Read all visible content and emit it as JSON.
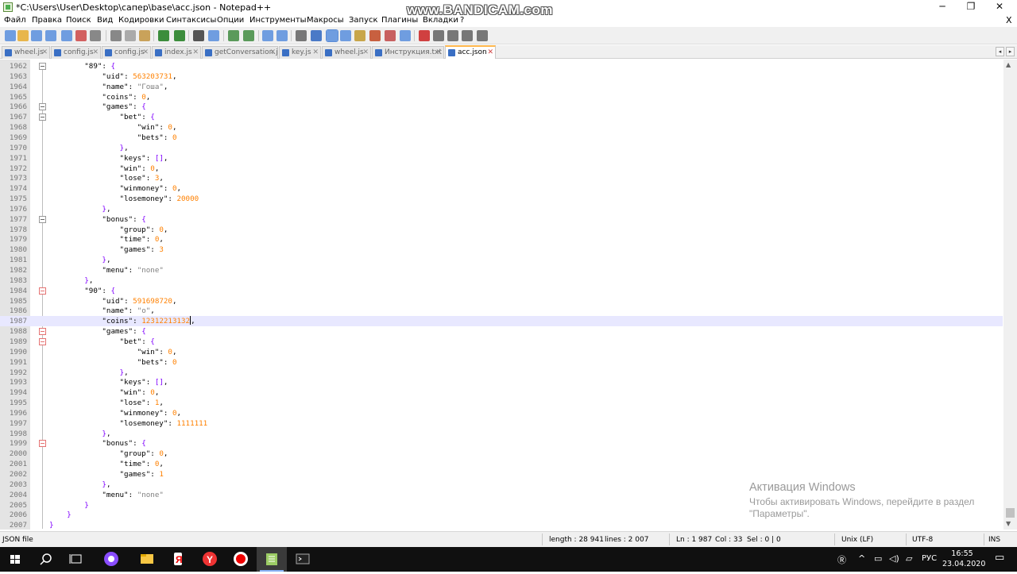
{
  "window": {
    "title": "*C:\\Users\\User\\Desktop\\сапер\\base\\acc.json - Notepad++",
    "minimize": "─",
    "restore": "❐",
    "close": "✕"
  },
  "watermark": "www.BANDICAM.com",
  "menu": {
    "items": [
      "Файл",
      "Правка",
      "Поиск",
      "Вид",
      "Кодировки",
      "Синтаксисы",
      "Опции",
      "Инструменты",
      "Макросы",
      "Запуск",
      "Плагины",
      "Вкладки",
      "?"
    ],
    "close_doc": "X"
  },
  "tabs": [
    {
      "label": "wheel.js",
      "active": false
    },
    {
      "label": "config.js",
      "active": false
    },
    {
      "label": "config.js",
      "active": false
    },
    {
      "label": "index.js",
      "active": false
    },
    {
      "label": "getConversation.js",
      "active": false
    },
    {
      "label": "key.js",
      "active": false
    },
    {
      "label": "wheel.js",
      "active": false
    },
    {
      "label": "Инструкция.txt",
      "active": false
    },
    {
      "label": "acc.json",
      "active": true
    }
  ],
  "tab_close": "✕",
  "tab_nav": {
    "left": "◂",
    "right": "▸"
  },
  "editor": {
    "lines": [
      {
        "no": "1962",
        "text": "        \"89\": {"
      },
      {
        "no": "1963",
        "text": "            \"uid\": 563203731,"
      },
      {
        "no": "1964",
        "text": "            \"name\": \"Гоша\","
      },
      {
        "no": "1965",
        "text": "            \"coins\": 0,"
      },
      {
        "no": "1966",
        "text": "            \"games\": {"
      },
      {
        "no": "1967",
        "text": "                \"bet\": {"
      },
      {
        "no": "1968",
        "text": "                    \"win\": 0,"
      },
      {
        "no": "1969",
        "text": "                    \"bets\": 0"
      },
      {
        "no": "1970",
        "text": "                },"
      },
      {
        "no": "1971",
        "text": "                \"keys\": [],"
      },
      {
        "no": "1972",
        "text": "                \"win\": 0,"
      },
      {
        "no": "1973",
        "text": "                \"lose\": 3,"
      },
      {
        "no": "1974",
        "text": "                \"winmoney\": 0,"
      },
      {
        "no": "1975",
        "text": "                \"losemoney\": 20000"
      },
      {
        "no": "1976",
        "text": "            },"
      },
      {
        "no": "1977",
        "text": "            \"bonus\": {"
      },
      {
        "no": "1978",
        "text": "                \"group\": 0,"
      },
      {
        "no": "1979",
        "text": "                \"time\": 0,"
      },
      {
        "no": "1980",
        "text": "                \"games\": 3"
      },
      {
        "no": "1981",
        "text": "            },"
      },
      {
        "no": "1982",
        "text": "            \"menu\": \"none\""
      },
      {
        "no": "1983",
        "text": "        },"
      },
      {
        "no": "1984",
        "text": "        \"90\": {"
      },
      {
        "no": "1985",
        "text": "            \"uid\": 591698720,"
      },
      {
        "no": "1986",
        "text": "            \"name\": \"о\","
      },
      {
        "no": "1987",
        "text": "            \"coins\": 12312213132,"
      },
      {
        "no": "1988",
        "text": "            \"games\": {"
      },
      {
        "no": "1989",
        "text": "                \"bet\": {"
      },
      {
        "no": "1990",
        "text": "                    \"win\": 0,"
      },
      {
        "no": "1991",
        "text": "                    \"bets\": 0"
      },
      {
        "no": "1992",
        "text": "                },"
      },
      {
        "no": "1993",
        "text": "                \"keys\": [],"
      },
      {
        "no": "1994",
        "text": "                \"win\": 0,"
      },
      {
        "no": "1995",
        "text": "                \"lose\": 1,"
      },
      {
        "no": "1996",
        "text": "                \"winmoney\": 0,"
      },
      {
        "no": "1997",
        "text": "                \"losemoney\": 1111111"
      },
      {
        "no": "1998",
        "text": "            },"
      },
      {
        "no": "1999",
        "text": "            \"bonus\": {"
      },
      {
        "no": "2000",
        "text": "                \"group\": 0,"
      },
      {
        "no": "2001",
        "text": "                \"time\": 0,"
      },
      {
        "no": "2002",
        "text": "                \"games\": 1"
      },
      {
        "no": "2003",
        "text": "            },"
      },
      {
        "no": "2004",
        "text": "            \"menu\": \"none\""
      },
      {
        "no": "2005",
        "text": "        }"
      },
      {
        "no": "2006",
        "text": "    }"
      },
      {
        "no": "2007",
        "text": "}"
      }
    ],
    "current_line": "1987",
    "language": "JSON"
  },
  "activation": {
    "line1": "Активация Windows",
    "line2": "Чтобы активировать Windows, перейдите в раздел",
    "line3": "\"Параметры\"."
  },
  "status": {
    "filetype": "JSON file",
    "length": "length : 28 941",
    "lines": "lines : 2 007",
    "ln": "Ln : 1 987",
    "col": "Col : 33",
    "sel": "Sel : 0 | 0",
    "eol": "Unix (LF)",
    "encoding": "UTF-8",
    "mode": "INS"
  },
  "taskbar": {
    "lang": "РУС",
    "time": "16:55",
    "date": "23.04.2020"
  }
}
